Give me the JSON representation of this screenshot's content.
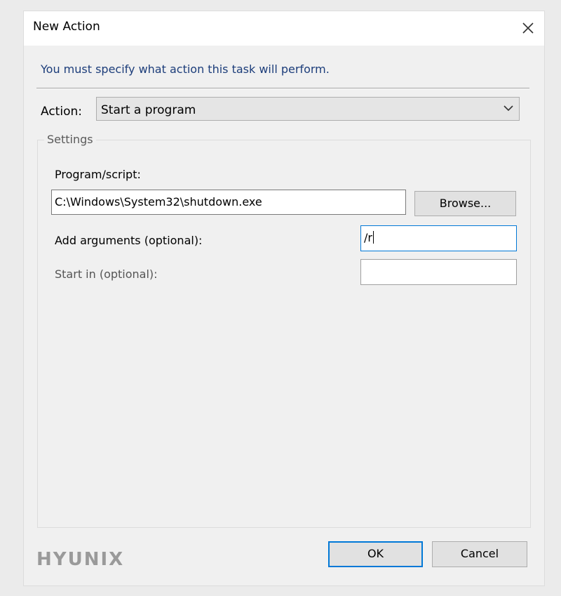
{
  "window": {
    "title": "New Action"
  },
  "instruction": "You must specify what action this task will perform.",
  "action": {
    "label": "Action:",
    "selected": "Start a program"
  },
  "settings": {
    "legend": "Settings",
    "program_label": "Program/script:",
    "program_value": "C:\\Windows\\System32\\shutdown.exe",
    "browse_label": "Browse...",
    "arguments_label": "Add arguments (optional):",
    "arguments_value": "/r",
    "start_in_label": "Start in (optional):",
    "start_in_value": ""
  },
  "buttons": {
    "ok": "OK",
    "cancel": "Cancel"
  },
  "watermark": "HYUNIX",
  "icons": {
    "close": "close-icon",
    "dropdown": "chevron-down-icon"
  },
  "colors": {
    "focus_border": "#0078d7",
    "instruction_text": "#1c3d7a"
  }
}
